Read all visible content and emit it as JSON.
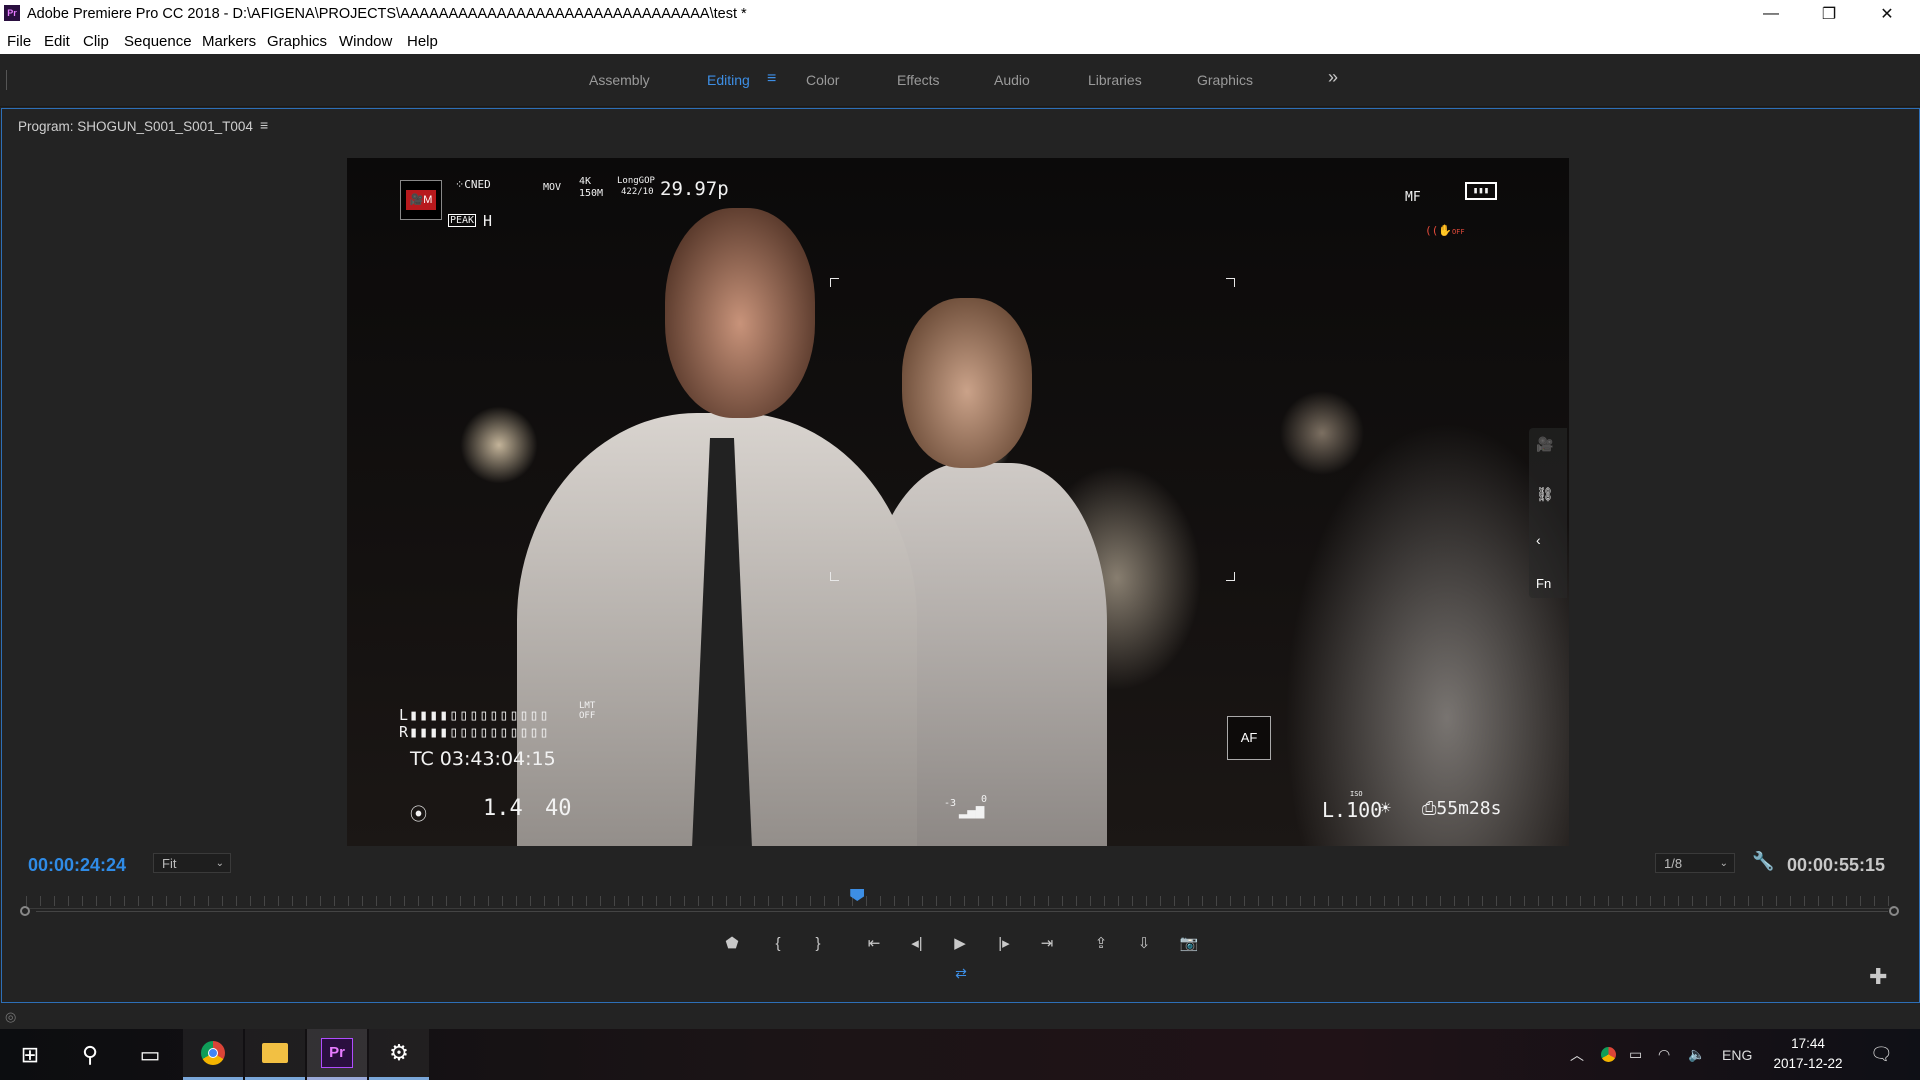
{
  "window": {
    "app_icon": "Pr",
    "title": "Adobe Premiere Pro CC 2018 - D:\\AFIGENA\\PROJECTS\\AAAAAAAAAAAAAAAAAAAAAAAAAAAAAAAA\\test *",
    "controls": {
      "minimize": "—",
      "restore": "❐",
      "close": "✕"
    }
  },
  "menu": [
    "File",
    "Edit",
    "Clip",
    "Sequence",
    "Markers",
    "Graphics",
    "Window",
    "Help"
  ],
  "workspaces": {
    "tabs": [
      "Assembly",
      "Editing",
      "Color",
      "Effects",
      "Audio",
      "Libraries",
      "Graphics"
    ],
    "active": "Editing",
    "menu_icon": "hamburger-icon",
    "more_icon": "double-chevron-right-icon",
    "accent": "#3d8ee4"
  },
  "panel": {
    "title": "Program: SHOGUN_S001_S001_T004",
    "menu_icon": "hamburger-icon"
  },
  "osd": {
    "rec_label": "M",
    "cned": "CNED",
    "peak": "PEAK",
    "peak_level": "H",
    "format": "MOV",
    "res_top": "4K",
    "res_bottom": "150M",
    "codec_top": "LongGOP",
    "codec_bottom": "422/10",
    "framerate": "29.97p",
    "focus_mode": "MF",
    "battery_icon": "battery-icon",
    "stabilizer_label": "OFF",
    "meter_l": "L",
    "meter_r": "R",
    "lmt_top": "LMT",
    "lmt_bottom": "OFF",
    "timecode": "TC 03:43:04:15",
    "aperture": "1.4",
    "shutter": "40",
    "iso": "L.100",
    "iso_label": "ISO",
    "remaining": "55m28s",
    "af_label": "AF",
    "side_fn": "Fn",
    "audio_level_top": "-3",
    "audio_level_bottom": "0"
  },
  "monitor": {
    "current_timecode": "00:00:24:24",
    "zoom": "Fit",
    "resolution": "1/8",
    "duration": "00:00:55:15",
    "playhead_fraction": 0.445
  },
  "transport": [
    {
      "name": "add-marker-button",
      "icon": "marker-icon",
      "glyph": "⬟"
    },
    {
      "name": "mark-in-button",
      "icon": "mark-in-icon",
      "glyph": "{"
    },
    {
      "name": "mark-out-button",
      "icon": "mark-out-icon",
      "glyph": "}"
    },
    {
      "name": "go-to-in-button",
      "icon": "go-to-in-icon",
      "glyph": "⇤"
    },
    {
      "name": "step-back-button",
      "icon": "step-back-icon",
      "glyph": "◂|"
    },
    {
      "name": "play-button",
      "icon": "play-icon",
      "glyph": "▶"
    },
    {
      "name": "step-forward-button",
      "icon": "step-forward-icon",
      "glyph": "|▸"
    },
    {
      "name": "go-to-out-button",
      "icon": "go-to-out-icon",
      "glyph": "⇥"
    },
    {
      "name": "lift-button",
      "icon": "lift-icon",
      "glyph": "⇪"
    },
    {
      "name": "extract-button",
      "icon": "extract-icon",
      "glyph": "⇩"
    },
    {
      "name": "export-frame-button",
      "icon": "camera-icon",
      "glyph": "📷"
    }
  ],
  "taskbar": {
    "language": "ENG",
    "time": "17:44",
    "date": "2017-12-22"
  }
}
